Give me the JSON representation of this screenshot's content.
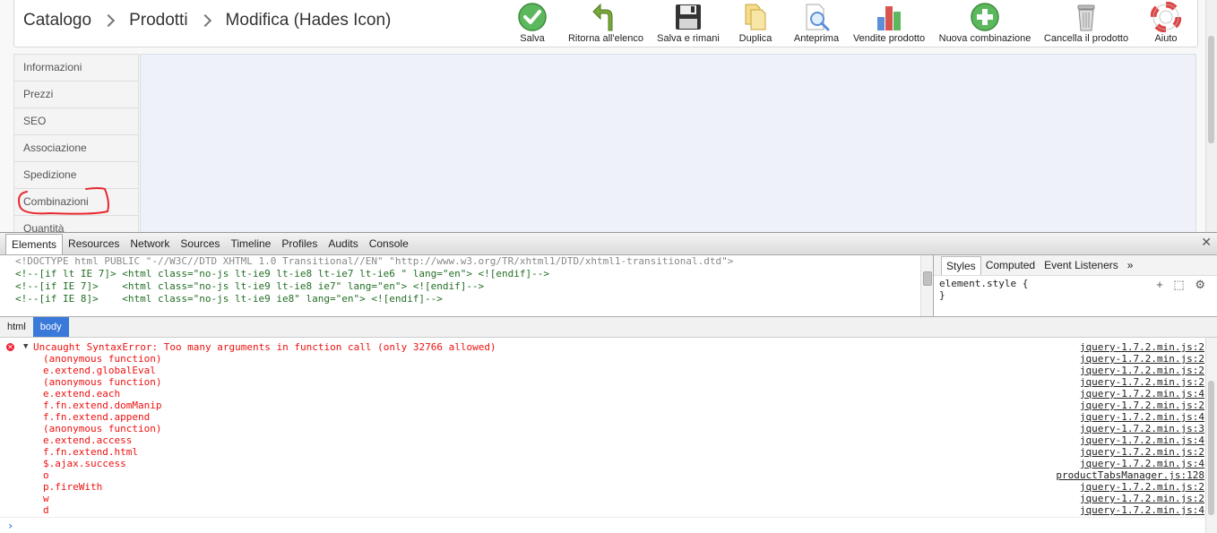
{
  "breadcrumb": {
    "items": [
      "Catalogo",
      "Prodotti",
      "Modifica (Hades Icon)"
    ]
  },
  "toolbar": {
    "buttons": [
      {
        "label": "Salva",
        "icon": "save-check-icon",
        "color": "#5cb85c"
      },
      {
        "label": "Ritorna all'elenco",
        "icon": "back-arrow-icon",
        "color": "#7aa83a"
      },
      {
        "label": "Salva e rimani",
        "icon": "floppy-disk-icon",
        "color": "#333333"
      },
      {
        "label": "Duplica",
        "icon": "duplicate-icon",
        "color": "#e8c25a"
      },
      {
        "label": "Anteprima",
        "icon": "preview-icon",
        "color": "#5b8ed6"
      },
      {
        "label": "Vendite prodotto",
        "icon": "bar-chart-icon",
        "color": "#d9534f"
      },
      {
        "label": "Nuova combinazione",
        "icon": "add-icon",
        "color": "#5cb85c"
      },
      {
        "label": "Cancella il prodotto",
        "icon": "trash-icon",
        "color": "#999999"
      },
      {
        "label": "Aiuto",
        "icon": "lifebuoy-icon",
        "color": "#e04343"
      }
    ]
  },
  "tabs": {
    "items": [
      "Informazioni",
      "Prezzi",
      "SEO",
      "Associazione",
      "Spedizione",
      "Combinazioni",
      "Quantità"
    ]
  },
  "devtools": {
    "tabs": [
      "Elements",
      "Resources",
      "Network",
      "Sources",
      "Timeline",
      "Profiles",
      "Audits",
      "Console"
    ],
    "source_lines": [
      "<!DOCTYPE html PUBLIC \"-//W3C//DTD XHTML 1.0 Transitional//EN\" \"http://www.w3.org/TR/xhtml1/DTD/xhtml1-transitional.dtd\">",
      "<!--[if lt IE 7]> <html class=\"no-js lt-ie9 lt-ie8 lt-ie7 lt-ie6 \" lang=\"en\"> <![endif]-->",
      "<!--[if IE 7]>    <html class=\"no-js lt-ie9 lt-ie8 ie7\" lang=\"en\"> <![endif]-->",
      "<!--[if IE 8]>    <html class=\"no-js lt-ie9 ie8\" lang=\"en\"> <![endif]-->"
    ],
    "styles_tabs": [
      "Styles",
      "Computed",
      "Event Listeners"
    ],
    "styles_more": "»",
    "element_style_open": "element.style {",
    "element_style_close": "}",
    "crumbs": [
      "html",
      "body"
    ],
    "error_message": "Uncaught SyntaxError: Too many arguments in function call (only 32766 allowed)",
    "error_source": "jquery-1.7.2.min.js:2",
    "stack": [
      {
        "fn": "(anonymous function)",
        "src": "jquery-1.7.2.min.js:2"
      },
      {
        "fn": "e.extend.globalEval",
        "src": "jquery-1.7.2.min.js:2"
      },
      {
        "fn": "(anonymous function)",
        "src": "jquery-1.7.2.min.js:2"
      },
      {
        "fn": "e.extend.each",
        "src": "jquery-1.7.2.min.js:4"
      },
      {
        "fn": "f.fn.extend.domManip",
        "src": "jquery-1.7.2.min.js:2"
      },
      {
        "fn": "f.fn.extend.append",
        "src": "jquery-1.7.2.min.js:4"
      },
      {
        "fn": "(anonymous function)",
        "src": "jquery-1.7.2.min.js:3"
      },
      {
        "fn": "e.extend.access",
        "src": "jquery-1.7.2.min.js:4"
      },
      {
        "fn": "f.fn.extend.html",
        "src": "jquery-1.7.2.min.js:2"
      },
      {
        "fn": "$.ajax.success",
        "src": "jquery-1.7.2.min.js:4"
      },
      {
        "fn": "o",
        "src": "productTabsManager.js:128"
      },
      {
        "fn": "p.fireWith",
        "src": "jquery-1.7.2.min.js:2"
      },
      {
        "fn": "w",
        "src": "jquery-1.7.2.min.js:2"
      },
      {
        "fn": "d",
        "src": "jquery-1.7.2.min.js:4"
      }
    ],
    "prompt": "›"
  }
}
